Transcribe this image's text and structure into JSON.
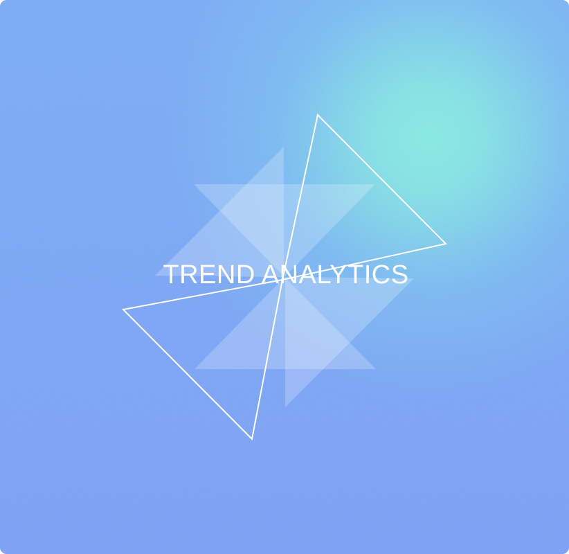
{
  "title": "TREND ANALYTICS",
  "colors": {
    "base": "#7ba4f3",
    "glow": "#86e8e0",
    "text": "#ffffff"
  },
  "icon": "pinwheel-triangles-icon"
}
